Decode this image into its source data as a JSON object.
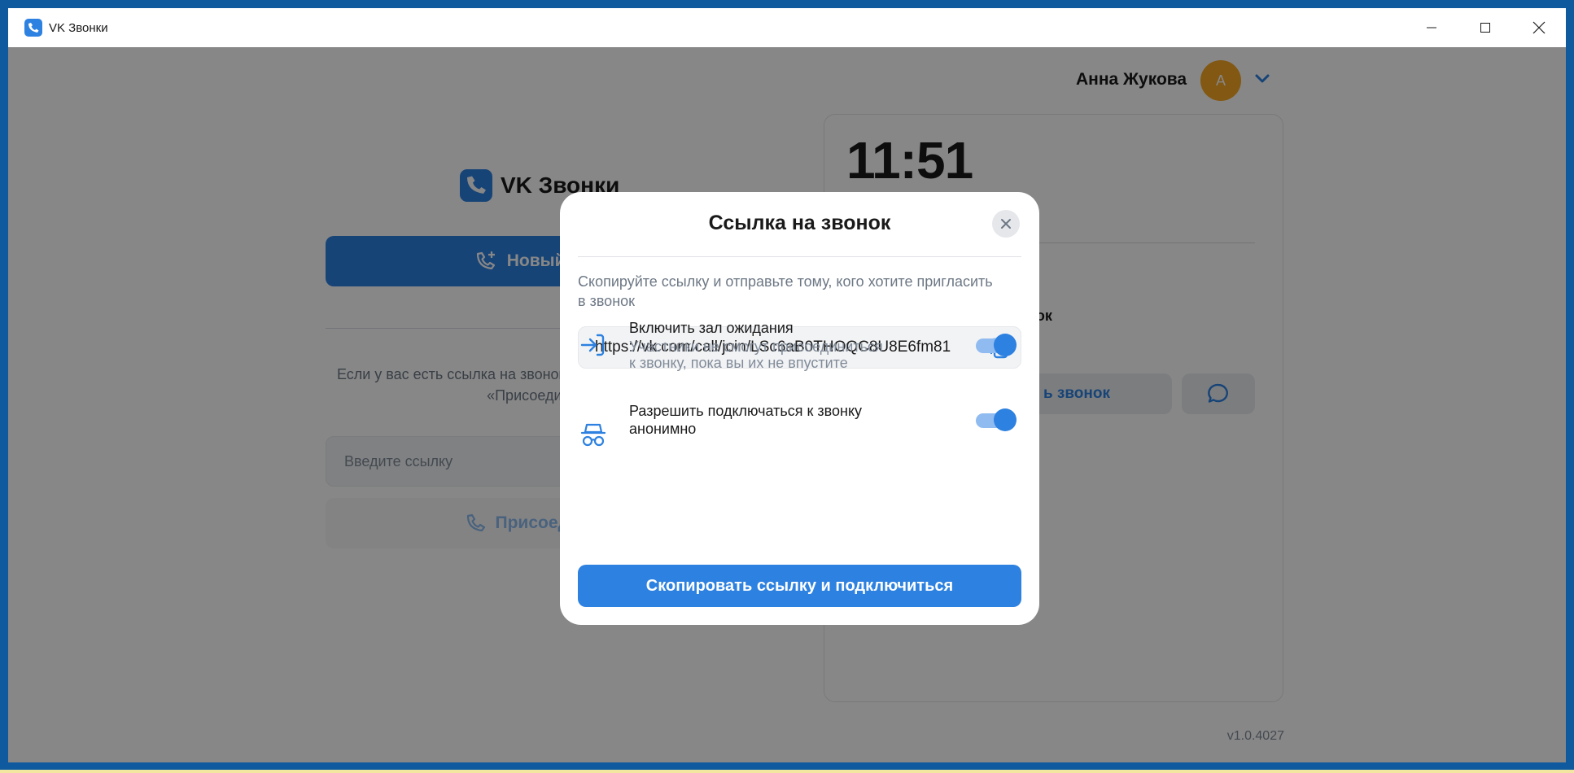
{
  "window": {
    "title": "VK Звонки",
    "controls": [
      "minimize-icon",
      "maximize-icon",
      "close-icon"
    ]
  },
  "header": {
    "user_name": "Анна Жукова",
    "avatar_letter": "А"
  },
  "left_panel": {
    "brand": "VK Звонки",
    "new_call_label": "Новый звонок",
    "join_hint": "Если у вас есть ссылка на звонок, вставьте её ниже и нажмите «Присоединиться»",
    "link_placeholder": "Введите ссылку",
    "join_label": "Присоединиться"
  },
  "right_card": {
    "time": "11:51",
    "snippet": "нок",
    "button_label": "ь звонок"
  },
  "version": "v1.0.4027",
  "modal": {
    "title": "Ссылка на звонок",
    "description": "Скопируйте ссылку и отправьте тому, кого хотите пригласить в звонок",
    "link": "https://vk.com/call/join/LSc6aB0THOQC8U8E6fm81",
    "options": [
      {
        "title": "Включить зал ожидания",
        "subtitle_line1": "Участники не смогут присоединиться",
        "subtitle_line2": "к звонку, пока вы их не впустите",
        "enabled": true
      },
      {
        "title_line1": "Разрешить подключаться к звонку",
        "title_line2": "анонимно",
        "enabled": true
      }
    ],
    "primary_button": "Скопировать ссылку и подключиться"
  },
  "colors": {
    "accent": "#2d81e0",
    "frame": "#0f5a9e",
    "avatar": "#f5a623"
  }
}
